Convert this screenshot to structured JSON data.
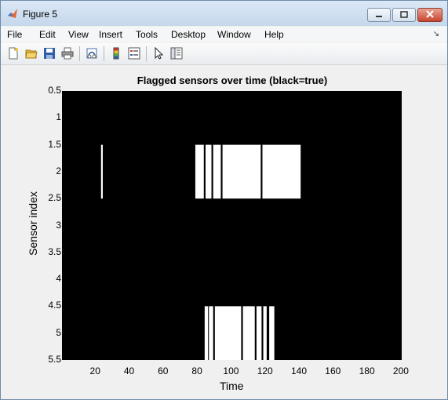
{
  "window": {
    "title": "Figure 5",
    "controls": [
      "minimize",
      "maximize",
      "close"
    ]
  },
  "menu": {
    "items": [
      "File",
      "Edit",
      "View",
      "Insert",
      "Tools",
      "Desktop",
      "Window",
      "Help"
    ],
    "overflow_icon": "menu-dock-arrow"
  },
  "toolbar": {
    "icons": [
      "new-figure-icon",
      "open-file-icon",
      "save-icon",
      "print-icon",
      "link-plot-icon",
      "insert-colorbar-icon",
      "insert-legend-icon",
      "pointer-icon",
      "property-inspector-icon"
    ]
  },
  "chart_data": {
    "type": "heatmap",
    "title": "Flagged sensors over time (black=true)",
    "xlabel": "Time",
    "ylabel": "Sensor index",
    "xlim": [
      0.5,
      200.5
    ],
    "ylim": [
      0.5,
      5.5
    ],
    "y_reversed": true,
    "xticks": [
      20,
      40,
      60,
      80,
      100,
      120,
      140,
      160,
      180,
      200
    ],
    "yticks": [
      "0.5",
      "1",
      "1.5",
      "2",
      "2.5",
      "3",
      "3.5",
      "4",
      "4.5",
      "5",
      "5.5"
    ],
    "colors": {
      "true": "#000000",
      "false": "#ffffff"
    },
    "rows": [
      {
        "row_from": 1.5,
        "row_to": 2.5,
        "white_intervals": [
          [
            23.5,
            24.5
          ],
          [
            79,
            84
          ],
          [
            85,
            88.5
          ],
          [
            89.5,
            94
          ],
          [
            95,
            117.5
          ],
          [
            118.5,
            141
          ]
        ]
      },
      {
        "row_from": 4.5,
        "row_to": 5.5,
        "white_intervals": [
          [
            84.5,
            86.5
          ],
          [
            87,
            89.5
          ],
          [
            90.5,
            106
          ],
          [
            107,
            114
          ],
          [
            115,
            118
          ],
          [
            119,
            121
          ],
          [
            122.5,
            125.5
          ]
        ]
      }
    ]
  }
}
